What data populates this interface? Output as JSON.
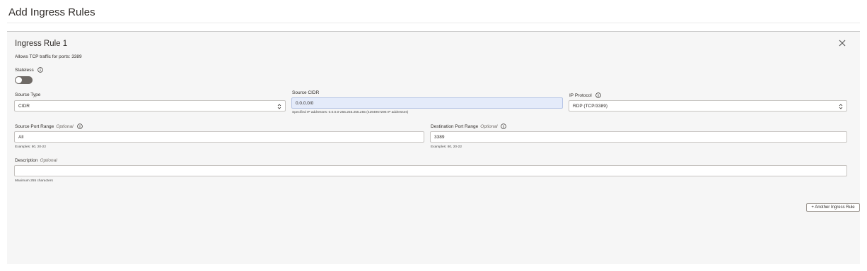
{
  "page": {
    "title": "Add Ingress Rules"
  },
  "rule": {
    "title": "Ingress Rule 1",
    "summary": "Allows TCP traffic for ports: 3389",
    "stateless": {
      "label": "Stateless",
      "value": false
    },
    "source_type": {
      "label": "Source Type",
      "value": "CIDR"
    },
    "source_cidr": {
      "label": "Source CIDR",
      "value": "0.0.0.0/0",
      "help": "Specified IP addresses: 0.0.0.0-255.255.255.255 (4294967296 IP addresses)"
    },
    "ip_protocol": {
      "label": "IP Protocol",
      "value": "RDP (TCP/3389)"
    },
    "source_port_range": {
      "label": "Source Port Range",
      "optional": "Optional",
      "value": "All",
      "help": "Examples: 80, 20-22"
    },
    "destination_port_range": {
      "label": "Destination Port Range",
      "optional": "Optional",
      "value": "3389",
      "help": "Examples: 80, 20-22"
    },
    "description": {
      "label": "Description",
      "optional": "Optional",
      "value": "",
      "help": "Maximum 255 characters"
    }
  },
  "actions": {
    "add_rule_label": "+ Another Ingress Rule"
  },
  "icons": {
    "close": "close-icon",
    "info": "info-icon",
    "select": "chevron-up-down-icon"
  },
  "colors": {
    "readonly_field": "#e4ebfa",
    "toggle_off": "#6f6a66"
  }
}
